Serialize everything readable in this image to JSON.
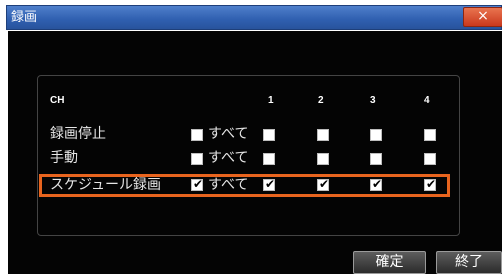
{
  "window": {
    "title": "録画",
    "close_label": "×"
  },
  "table": {
    "header": {
      "ch_label": "CH",
      "channels": [
        "1",
        "2",
        "3",
        "4"
      ]
    },
    "rows": [
      {
        "label": "録画停止",
        "all_label": "すべて",
        "all_checked": false,
        "channels_checked": [
          false,
          false,
          false,
          false
        ]
      },
      {
        "label": "手動",
        "all_label": "すべて",
        "all_checked": false,
        "channels_checked": [
          false,
          false,
          false,
          false
        ]
      },
      {
        "label": "スケジュール録画",
        "all_label": "すべて",
        "all_checked": true,
        "channels_checked": [
          true,
          true,
          true,
          true
        ]
      }
    ]
  },
  "buttons": {
    "ok_label": "確定",
    "exit_label": "終了"
  },
  "colors": {
    "highlight": "#e8641e",
    "titlebar": "#2f5fb0",
    "background": "#040404"
  }
}
